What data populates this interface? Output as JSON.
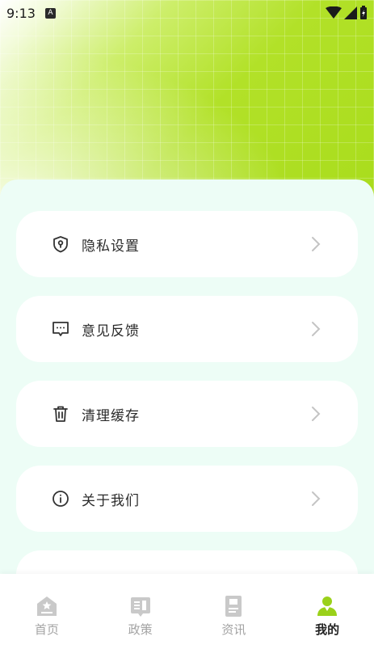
{
  "status_bar": {
    "time": "9:13",
    "notification_badge": "A"
  },
  "menu": [
    {
      "label": "隐私设置",
      "icon": "shield-lock-icon"
    },
    {
      "label": "意见反馈",
      "icon": "chat-dots-icon"
    },
    {
      "label": "清理缓存",
      "icon": "trash-icon"
    },
    {
      "label": "关于我们",
      "icon": "info-icon"
    }
  ],
  "tabs": [
    {
      "label": "首页",
      "icon": "home-icon",
      "active": false
    },
    {
      "label": "政策",
      "icon": "policy-icon",
      "active": false
    },
    {
      "label": "资讯",
      "icon": "news-icon",
      "active": false
    },
    {
      "label": "我的",
      "icon": "profile-icon",
      "active": true
    }
  ],
  "colors": {
    "accent": "#a9dc1c",
    "panel_bg": "#edfdf6",
    "inactive_tab": "#c9c9c9",
    "active_tab": "#9ad11a"
  }
}
